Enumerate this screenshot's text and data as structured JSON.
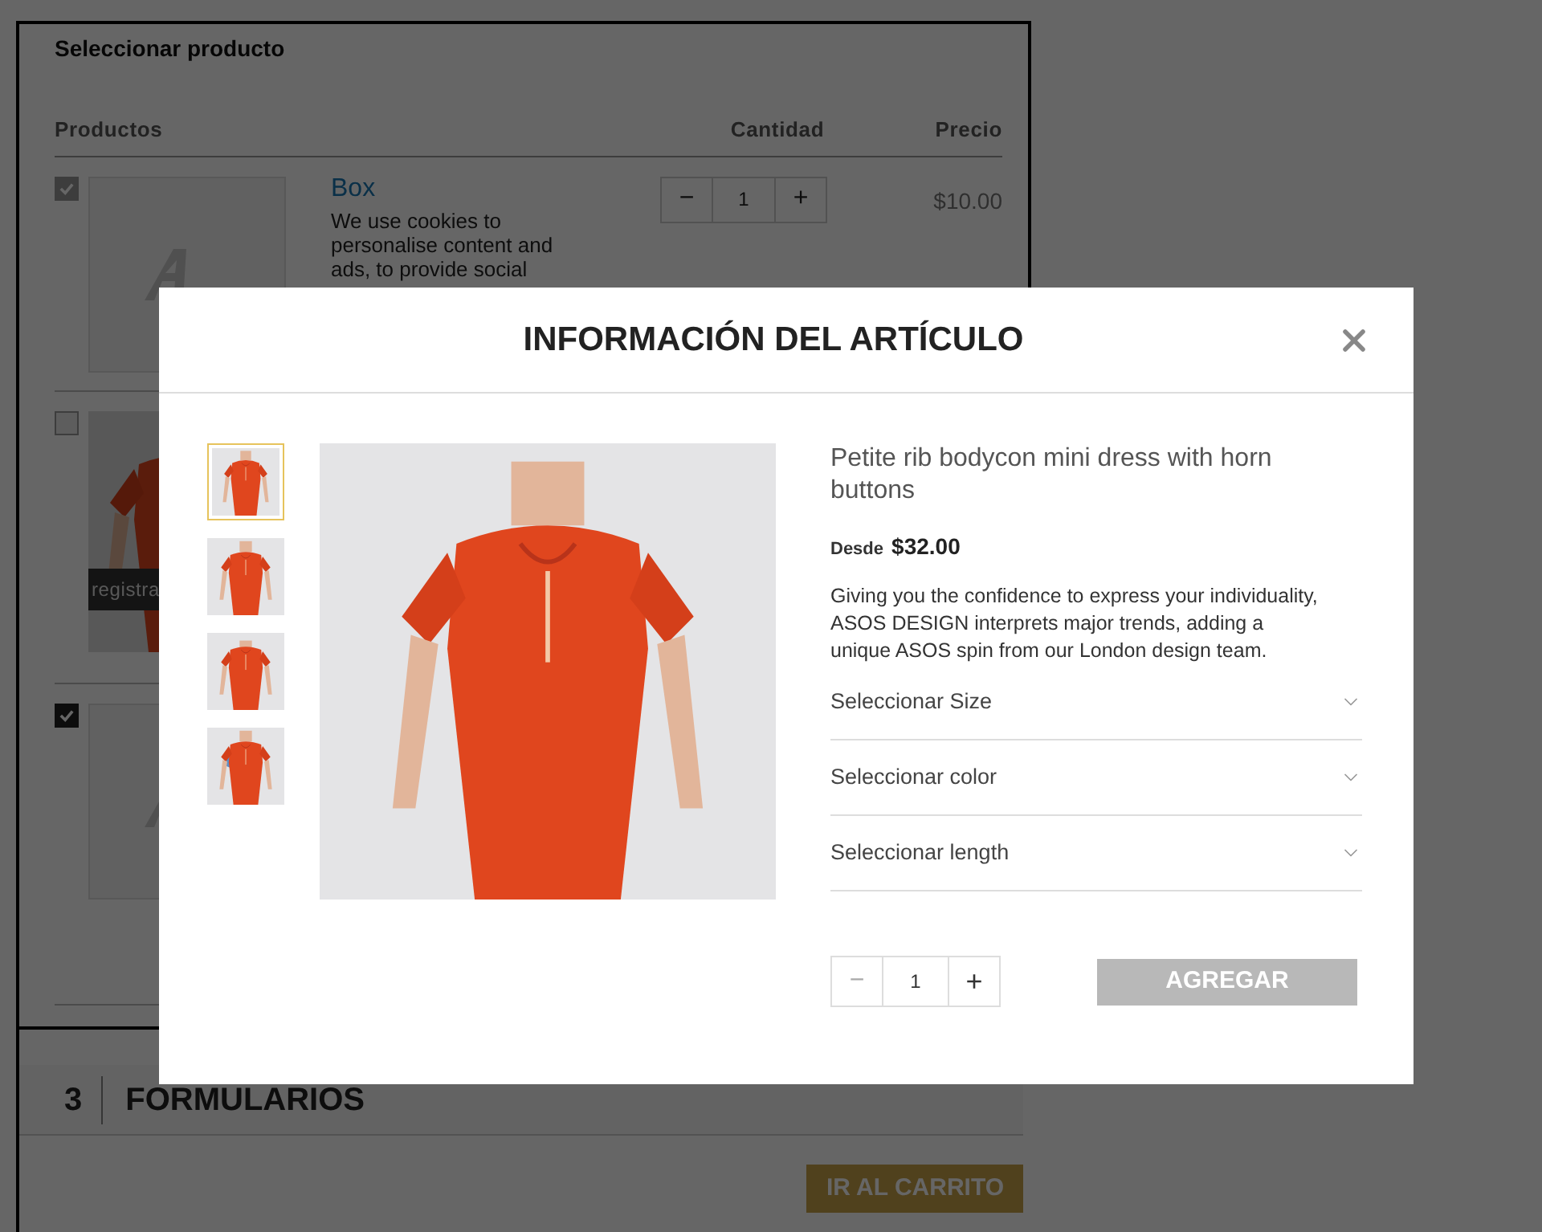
{
  "section": {
    "title": "Seleccionar producto",
    "columns": [
      "Productos",
      "Cantidad",
      "Precio"
    ],
    "products": [
      {
        "kind": "placeholder",
        "checked": true,
        "disabled": true,
        "name": "Box",
        "description": "We use cookies to personalise content and ads, to provide social",
        "quantity": "1",
        "minus": "−",
        "plus": "+",
        "price": "$10.00"
      },
      {
        "checked": false,
        "disabled": false,
        "overlay_text": "registra"
      },
      {
        "kind": "placeholder",
        "checked": true,
        "disabled": false
      }
    ]
  },
  "step": {
    "number": "3",
    "title": "FORMULARIOS"
  },
  "cart_button": {
    "label": "IR AL CARRITO"
  },
  "modal": {
    "title": "INFORMACIÓN DEL ARTÍCULO",
    "thumbnails": [
      {
        "kind": "picture",
        "selected": true
      },
      {
        "kind": "picture",
        "selected": false
      },
      {
        "kind": "picture",
        "selected": false
      },
      {
        "kind": "picture",
        "selected": false
      }
    ],
    "product_name": "Petite rib bodycon mini dress with horn buttons",
    "price_label": "Desde",
    "price": "$32.00",
    "description": "Giving you the confidence to express your individuality, ASOS DESIGN interprets major trends, adding a unique ASOS spin from our London design team.",
    "selects": [
      {
        "label": "Seleccionar Size"
      },
      {
        "label": "Seleccionar color"
      },
      {
        "label": "Seleccionar length"
      }
    ],
    "quantity": "1",
    "minus": "−",
    "plus": "+",
    "add_button": {
      "label": "AGREGAR",
      "disabled": true
    }
  }
}
